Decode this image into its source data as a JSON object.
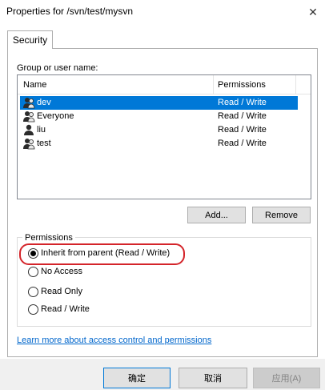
{
  "window": {
    "title": "Properties for /svn/test/mysvn",
    "close_glyph": "✕"
  },
  "tabs": [
    {
      "label": "Security",
      "active": true
    }
  ],
  "group_list": {
    "label": "Group or user name:",
    "columns": [
      "Name",
      "Permissions"
    ],
    "rows": [
      {
        "name": "dev",
        "permission": "Read / Write",
        "selected": true,
        "icon": "group-icon"
      },
      {
        "name": "Everyone",
        "permission": "Read / Write",
        "selected": false,
        "icon": "group-icon"
      },
      {
        "name": "liu",
        "permission": "Read / Write",
        "selected": false,
        "icon": "user-icon"
      },
      {
        "name": "test",
        "permission": "Read / Write",
        "selected": false,
        "icon": "group-icon"
      }
    ]
  },
  "buttons": {
    "add": "Add...",
    "remove": "Remove",
    "ok": "确定",
    "cancel": "取消",
    "apply": "应用(A)"
  },
  "permissions": {
    "legend": "Permissions",
    "options": [
      {
        "label": "Inherit from parent (Read / Write)",
        "checked": true
      },
      {
        "label": "No Access",
        "checked": false
      },
      {
        "label": "Read Only",
        "checked": false
      },
      {
        "label": "Read / Write",
        "checked": false
      }
    ]
  },
  "link": {
    "text": "Learn more about access control and permissions"
  },
  "colors": {
    "selection": "#0078d7",
    "highlight": "#d4242a",
    "link": "#0066cc"
  }
}
